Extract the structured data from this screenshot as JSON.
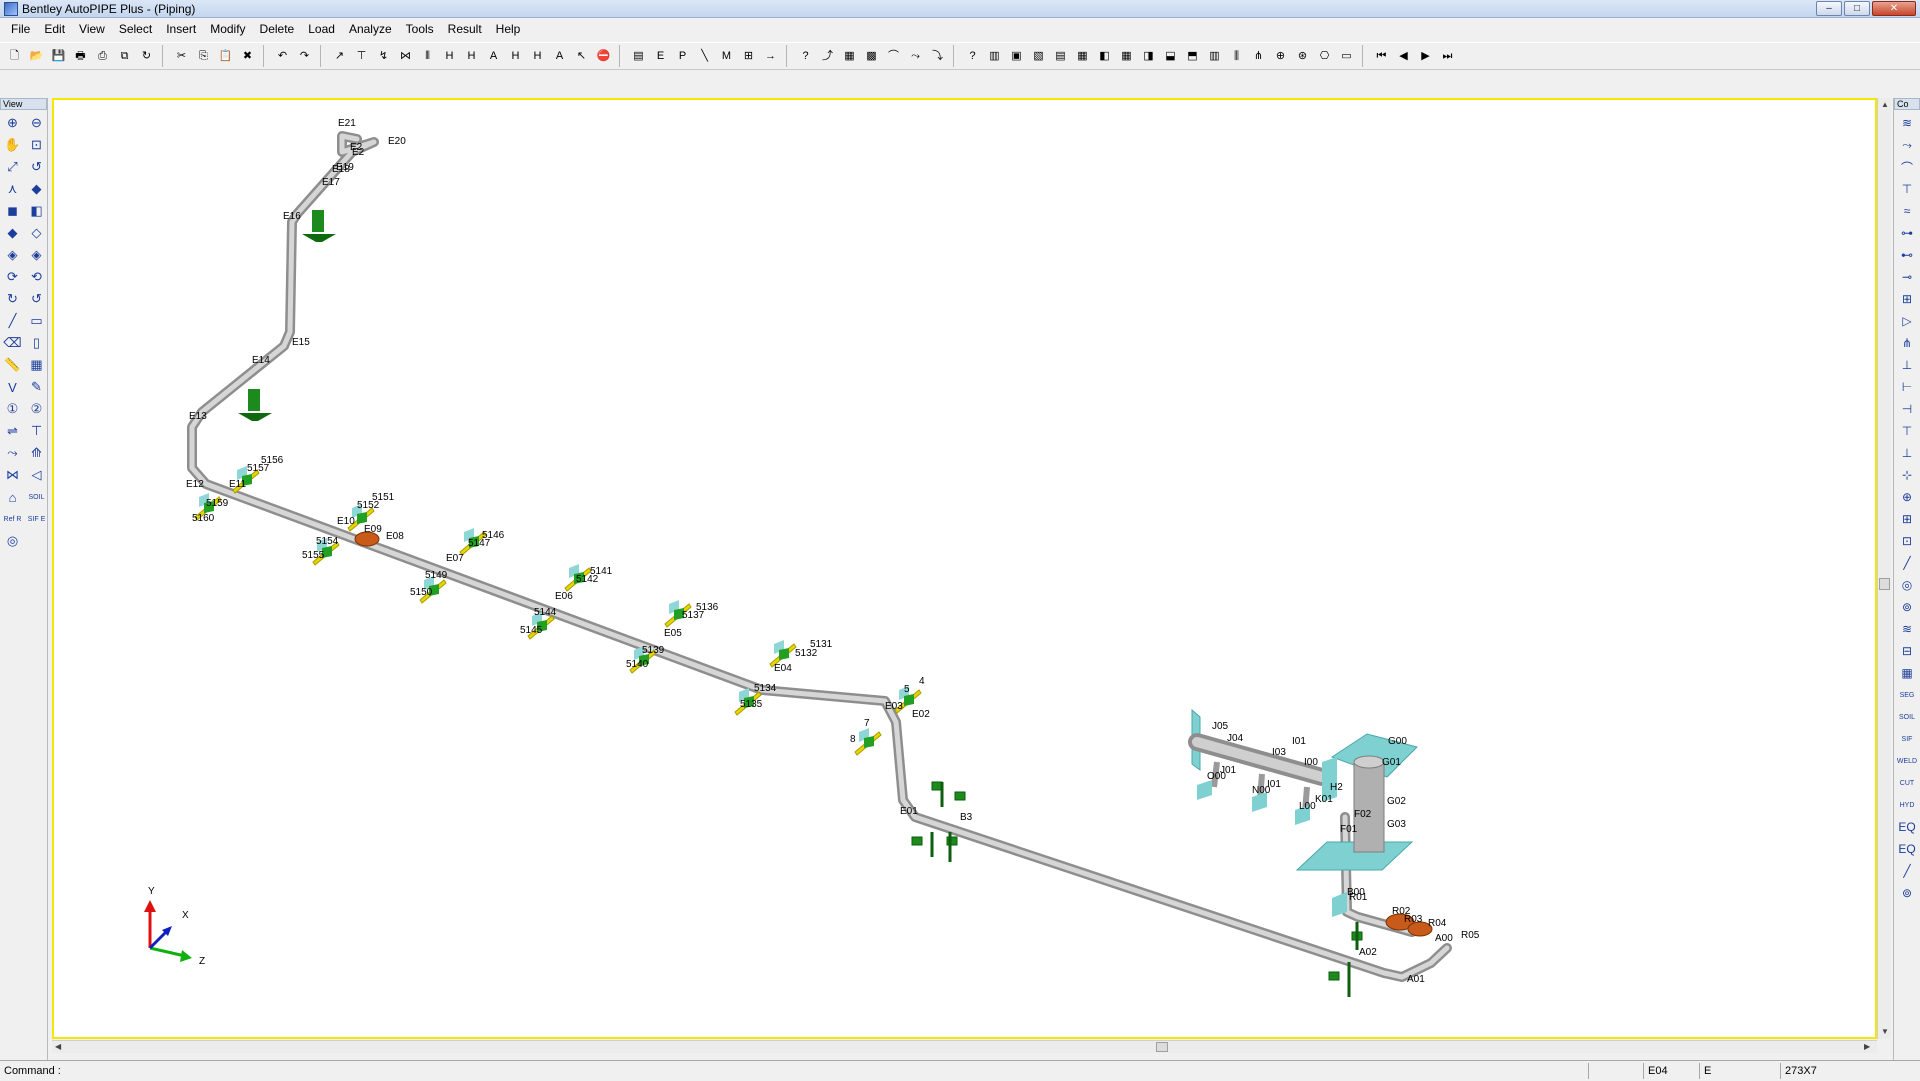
{
  "window": {
    "title": "Bentley AutoPIPE Plus - (Piping)",
    "minimize": "–",
    "maximize": "□",
    "close": "✕"
  },
  "menu": [
    "File",
    "Edit",
    "View",
    "Select",
    "Insert",
    "Modify",
    "Delete",
    "Load",
    "Analyze",
    "Tools",
    "Result",
    "Help"
  ],
  "toolbar": {
    "icons": [
      {
        "name": "new",
        "glyph": "🗋"
      },
      {
        "name": "open",
        "glyph": "📂"
      },
      {
        "name": "save",
        "glyph": "💾"
      },
      {
        "name": "print",
        "glyph": "🖶"
      },
      {
        "name": "print-preview",
        "glyph": "⎙"
      },
      {
        "name": "copy-model",
        "glyph": "⧉"
      },
      {
        "name": "refresh",
        "glyph": "↻"
      },
      {
        "name": "cut",
        "glyph": "✂"
      },
      {
        "name": "copy",
        "glyph": "⎘"
      },
      {
        "name": "paste",
        "glyph": "📋"
      },
      {
        "name": "delete",
        "glyph": "✖"
      },
      {
        "name": "undo",
        "glyph": "↶"
      },
      {
        "name": "redo",
        "glyph": "↷"
      },
      {
        "name": "insert-run",
        "glyph": "↗"
      },
      {
        "name": "insert-tee",
        "glyph": "⊤"
      },
      {
        "name": "insert-bend",
        "glyph": "↯"
      },
      {
        "name": "insert-valve",
        "glyph": "⋈"
      },
      {
        "name": "insert-flange",
        "glyph": "⫴"
      },
      {
        "name": "hide-a",
        "glyph": "H"
      },
      {
        "name": "hide-b",
        "glyph": "H"
      },
      {
        "name": "hide-all",
        "glyph": "A"
      },
      {
        "name": "hide-c",
        "glyph": "H"
      },
      {
        "name": "hide-d",
        "glyph": "H"
      },
      {
        "name": "all-b",
        "glyph": "A"
      },
      {
        "name": "select-pointer",
        "glyph": "↖"
      },
      {
        "name": "stop",
        "glyph": "⛔"
      },
      {
        "name": "document",
        "glyph": "▤"
      },
      {
        "name": "e9",
        "glyph": "E"
      },
      {
        "name": "ps1",
        "glyph": "P"
      },
      {
        "name": "line",
        "glyph": "╲"
      },
      {
        "name": "mt",
        "glyph": "M"
      },
      {
        "name": "grid-small",
        "glyph": "⊞"
      },
      {
        "name": "arrow-right",
        "glyph": "→"
      },
      {
        "name": "help-pointer",
        "glyph": "?"
      },
      {
        "name": "graph",
        "glyph": "⤴"
      },
      {
        "name": "matrix",
        "glyph": "▦"
      },
      {
        "name": "matrix-b",
        "glyph": "▩"
      },
      {
        "name": "bend-a",
        "glyph": "⌒"
      },
      {
        "name": "bend-b",
        "glyph": "⤳"
      },
      {
        "name": "bend-c",
        "glyph": "⤵"
      },
      {
        "name": "help",
        "glyph": "?"
      },
      {
        "name": "tool-1",
        "glyph": "▥"
      },
      {
        "name": "tool-2",
        "glyph": "▣"
      },
      {
        "name": "tool-3",
        "glyph": "▧"
      },
      {
        "name": "tool-4",
        "glyph": "▤"
      },
      {
        "name": "tool-5",
        "glyph": "▦"
      },
      {
        "name": "tool-6",
        "glyph": "◧"
      },
      {
        "name": "tool-7",
        "glyph": "▦"
      },
      {
        "name": "tool-8",
        "glyph": "◨"
      },
      {
        "name": "tool-9",
        "glyph": "⬓"
      },
      {
        "name": "tool-10",
        "glyph": "⬒"
      },
      {
        "name": "tool-11",
        "glyph": "▥"
      },
      {
        "name": "tool-12",
        "glyph": "⫼"
      },
      {
        "name": "tool-13",
        "glyph": "⋔"
      },
      {
        "name": "tool-14",
        "glyph": "⊕"
      },
      {
        "name": "tool-15",
        "glyph": "⊛"
      },
      {
        "name": "tool-16",
        "glyph": "⎔"
      },
      {
        "name": "tool-17",
        "glyph": "▭"
      },
      {
        "name": "first",
        "glyph": "⏮"
      },
      {
        "name": "prev",
        "glyph": "◀"
      },
      {
        "name": "next",
        "glyph": "▶"
      },
      {
        "name": "last",
        "glyph": "⏭"
      }
    ]
  },
  "left_panel": {
    "header": "View",
    "tools": [
      "zoom-in",
      "zoom-out",
      "pan",
      "zoom-window",
      "zoom-all",
      "zoom-previous",
      "view-iso",
      "view-3d",
      "view-front",
      "view-side",
      "shade-a",
      "shade-b",
      "shade-c",
      "shade-d",
      "rotate-x",
      "rotate-y",
      "rotate-z",
      "rotate-back",
      "line-draw",
      "box-draw",
      "eraser",
      "split",
      "ruler",
      "table",
      "vector",
      "tag",
      "point-a",
      "point-b",
      "support",
      "load",
      "bend-arrow",
      "tee-arrow",
      "valve",
      "flange",
      "anchor",
      "soil",
      "ref",
      "sif",
      "ring"
    ],
    "glyphs": [
      "⊕",
      "⊖",
      "✋",
      "⊡",
      "⤢",
      "↺",
      "⋏",
      "◆",
      "◼",
      "◧",
      "◆",
      "◇",
      "◈",
      "◈",
      "⟳",
      "⟲",
      "↻",
      "↺",
      "╱",
      "▭",
      "⌫",
      "▯",
      "📏",
      "▦",
      "V",
      "✎",
      "①",
      "②",
      "⇌",
      "⊤",
      "⤳",
      "⟰",
      "⋈",
      "◁",
      "⌂",
      "SOIL",
      "Ref R",
      "SIF E",
      "◎"
    ]
  },
  "right_panel": {
    "header": "Co",
    "glyphs": [
      "≋",
      "⤳",
      "⌒",
      "⊤",
      "≈",
      "⊶",
      "⊷",
      "⊸",
      "⊞",
      "▷",
      "⋔",
      "⊥",
      "⊢",
      "⊣",
      "⊤",
      "⊥",
      "⊹",
      "⊕",
      "⊞",
      "⊡",
      "╱",
      "◎",
      "⊚",
      "≋",
      "⊟",
      "▦",
      "SEG",
      "SOIL",
      "SIF",
      "WELD",
      "CUT",
      "HYD",
      "EQ",
      "EQ",
      "╱",
      "⊚"
    ]
  },
  "viewport": {
    "nodes": [
      {
        "label": "E21"
      },
      {
        "label": "E20"
      },
      {
        "label": "E2"
      },
      {
        "label": "E2"
      },
      {
        "label": "E19"
      },
      {
        "label": "E18"
      },
      {
        "label": "E17"
      },
      {
        "label": "E16"
      },
      {
        "label": "E15"
      },
      {
        "label": "E14"
      },
      {
        "label": "E13"
      },
      {
        "label": "E12"
      },
      {
        "label": "E11"
      },
      {
        "label": "E10"
      },
      {
        "label": "E09"
      },
      {
        "label": "E08"
      },
      {
        "label": "E07"
      },
      {
        "label": "E06"
      },
      {
        "label": "E05"
      },
      {
        "label": "E04"
      },
      {
        "label": "E03"
      },
      {
        "label": "E02"
      },
      {
        "label": "E01"
      },
      {
        "label": "5156"
      },
      {
        "label": "5157"
      },
      {
        "label": "5159"
      },
      {
        "label": "5160"
      },
      {
        "label": "5151"
      },
      {
        "label": "5152"
      },
      {
        "label": "5154"
      },
      {
        "label": "5155"
      },
      {
        "label": "5146"
      },
      {
        "label": "5147"
      },
      {
        "label": "5149"
      },
      {
        "label": "5150"
      },
      {
        "label": "5141"
      },
      {
        "label": "5142"
      },
      {
        "label": "5144"
      },
      {
        "label": "5145"
      },
      {
        "label": "5136"
      },
      {
        "label": "5137"
      },
      {
        "label": "5139"
      },
      {
        "label": "5140"
      },
      {
        "label": "5131"
      },
      {
        "label": "5132"
      },
      {
        "label": "5134"
      },
      {
        "label": "5135"
      },
      {
        "label": "4"
      },
      {
        "label": "5"
      },
      {
        "label": "7"
      },
      {
        "label": "8"
      },
      {
        "label": "B3"
      },
      {
        "label": "J05"
      },
      {
        "label": "J04"
      },
      {
        "label": "I03"
      },
      {
        "label": "I01"
      },
      {
        "label": "I00"
      },
      {
        "label": "G00"
      },
      {
        "label": "G01"
      },
      {
        "label": "G02"
      },
      {
        "label": "G03"
      },
      {
        "label": "F02"
      },
      {
        "label": "F01"
      },
      {
        "label": "O00"
      },
      {
        "label": "J01"
      },
      {
        "label": "N00"
      },
      {
        "label": "I01"
      },
      {
        "label": "L00"
      },
      {
        "label": "K01"
      },
      {
        "label": "H2"
      },
      {
        "label": "B00"
      },
      {
        "label": "R01"
      },
      {
        "label": "R02"
      },
      {
        "label": "R03"
      },
      {
        "label": "A02"
      },
      {
        "label": "A01"
      },
      {
        "label": "A00"
      },
      {
        "label": "R05"
      },
      {
        "label": "R04"
      }
    ],
    "axis": {
      "y": "Y",
      "x": "X",
      "z": "Z"
    }
  },
  "statusbar": {
    "command_label": "Command :",
    "node": "E04",
    "segment": "E",
    "size": "273X7"
  }
}
